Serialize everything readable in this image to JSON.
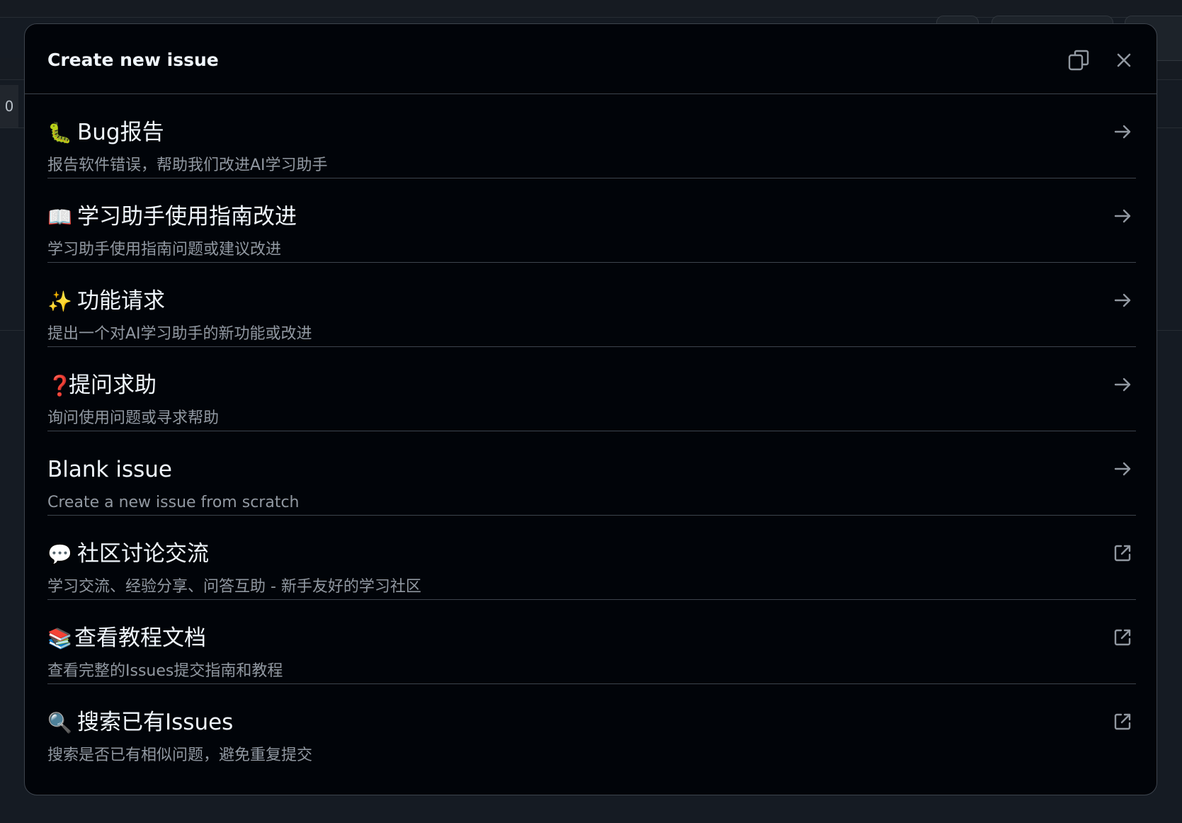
{
  "modal": {
    "title": "Create new issue"
  },
  "background": {
    "counter": "0"
  },
  "templates": [
    {
      "emoji": "🐛",
      "title": "Bug报告",
      "description": "报告软件错误，帮助我们改进AI学习助手",
      "action": "arrow-right-icon"
    },
    {
      "emoji": "📖",
      "title": "学习助手使用指南改进",
      "description": "学习助手使用指南问题或建议改进",
      "action": "arrow-right-icon"
    },
    {
      "emoji": "✨",
      "title": "功能请求",
      "description": "提出一个对AI学习助手的新功能或改进",
      "action": "arrow-right-icon"
    },
    {
      "emoji": "❓",
      "title": "提问求助",
      "description": "询问使用问题或寻求帮助",
      "action": "arrow-right-icon"
    },
    {
      "emoji": "",
      "title": "Blank issue",
      "description": "Create a new issue from scratch",
      "action": "arrow-right-icon"
    },
    {
      "emoji": "💬",
      "title": "社区讨论交流",
      "description": "学习交流、经验分享、问答互助 - 新手友好的学习社区",
      "action": "link-external-icon"
    },
    {
      "emoji": "📚",
      "title": "查看教程文档",
      "description": "查看完整的Issues提交指南和教程",
      "action": "link-external-icon"
    },
    {
      "emoji": "🔍",
      "title": "搜索已有Issues",
      "description": "搜索是否已有相似问题，避免重复提交",
      "action": "link-external-icon"
    }
  ],
  "colors": {
    "modal_bg": "#010409",
    "border": "#3d444d",
    "text_primary": "#f0f6fc",
    "text_muted": "#9198a1",
    "icon": "#9198a1"
  }
}
